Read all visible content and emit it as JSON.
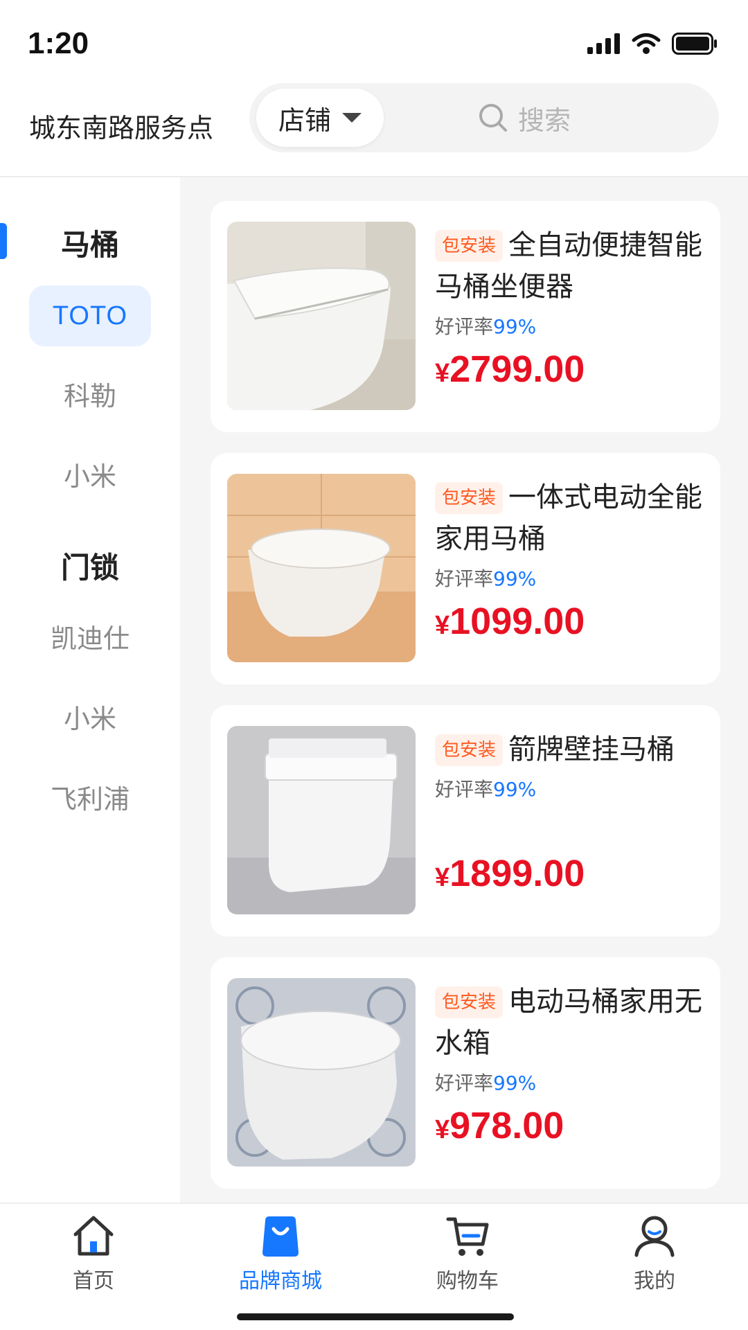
{
  "status_bar": {
    "time": "1:20"
  },
  "header": {
    "location": "城东南路服务点",
    "store_selector": "店铺",
    "search_placeholder": "搜索"
  },
  "sidebar": {
    "categories": [
      {
        "title": "马桶",
        "items": [
          "TOTO",
          "科勒",
          "小米"
        ]
      },
      {
        "title": "门锁",
        "items": [
          "凯迪仕",
          "小米",
          "飞利浦"
        ]
      }
    ],
    "active_item": "TOTO"
  },
  "products": [
    {
      "badge": "包安装",
      "title": "全自动便捷智能马桶坐便器",
      "rating_label": "好评率",
      "rating_value": "99%",
      "price_symbol": "¥",
      "price": "2799.00",
      "image_icon": "toilet-photo"
    },
    {
      "badge": "包安装",
      "title": "一体式电动全能家用马桶",
      "rating_label": "好评率",
      "rating_value": "99%",
      "price_symbol": "¥",
      "price": "1099.00",
      "image_icon": "toilet-photo"
    },
    {
      "badge": "包安装",
      "title": "箭牌壁挂马桶",
      "rating_label": "好评率",
      "rating_value": "99%",
      "price_symbol": "¥",
      "price": "1899.00",
      "image_icon": "toilet-photo"
    },
    {
      "badge": "包安装",
      "title": "电动马桶家用无水箱",
      "rating_label": "好评率",
      "rating_value": "99%",
      "price_symbol": "¥",
      "price": "978.00",
      "image_icon": "toilet-photo"
    }
  ],
  "tabbar": {
    "items": [
      {
        "label": "首页",
        "icon": "home-icon"
      },
      {
        "label": "品牌商城",
        "icon": "shopping-bag-icon"
      },
      {
        "label": "购物车",
        "icon": "cart-icon"
      },
      {
        "label": "我的",
        "icon": "user-icon"
      }
    ],
    "active": "品牌商城"
  },
  "colors": {
    "accent": "#1677ff",
    "price": "#e81123",
    "badge_text": "#ff5a1f",
    "badge_bg": "#fff1ea"
  }
}
